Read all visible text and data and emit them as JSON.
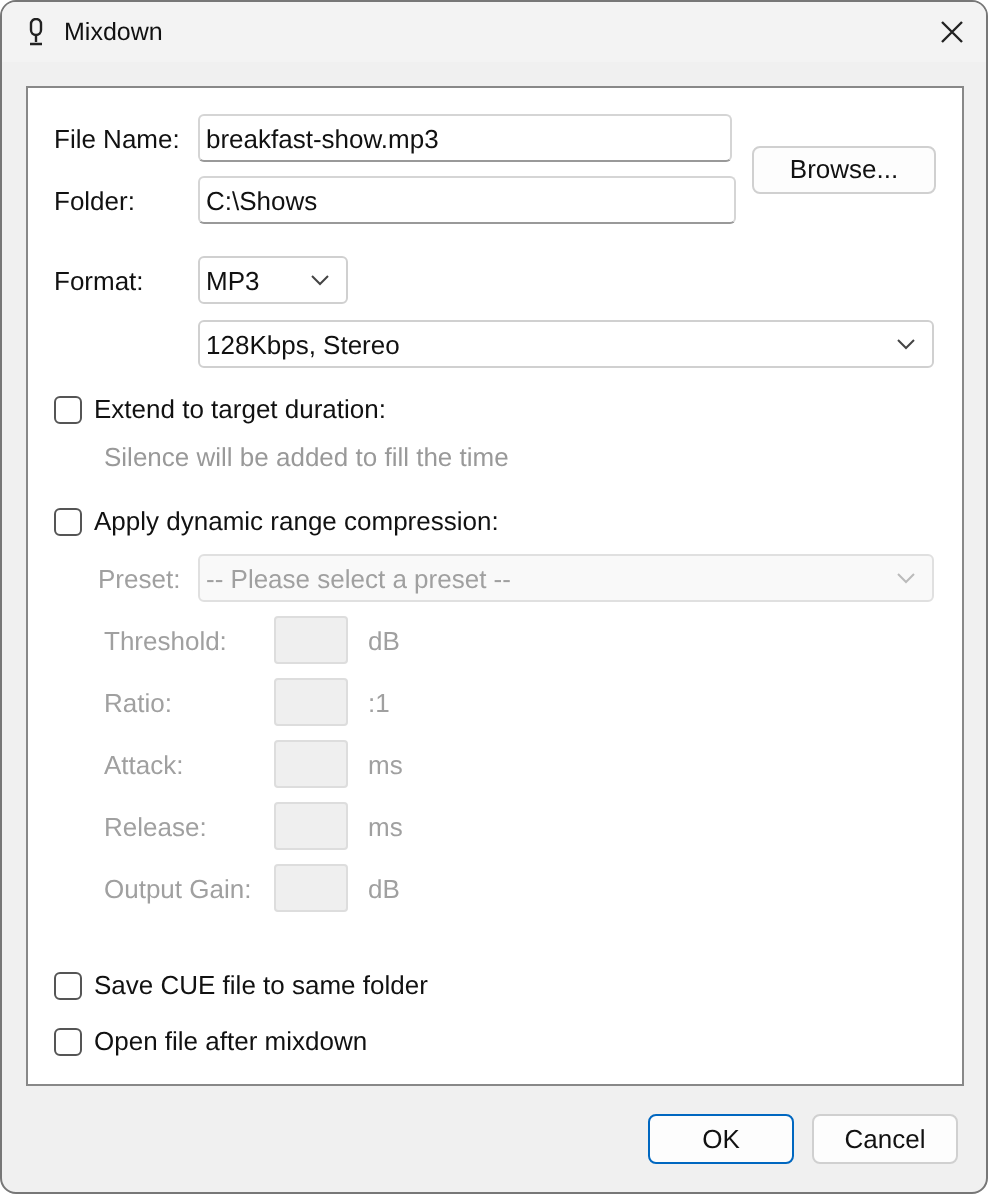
{
  "window": {
    "title": "Mixdown"
  },
  "file_name": {
    "label": "File Name:",
    "value": "breakfast-show.mp3"
  },
  "folder": {
    "label": "Folder:",
    "value": "C:\\Shows"
  },
  "browse_button": "Browse...",
  "format": {
    "label": "Format:",
    "value": "MP3",
    "quality": "128Kbps, Stereo"
  },
  "extend": {
    "label": "Extend to target duration:",
    "checked": false,
    "hint": "Silence will be added to fill the time"
  },
  "compression": {
    "label": "Apply dynamic range compression:",
    "checked": false,
    "disabled": true,
    "preset": {
      "label": "Preset:",
      "placeholder": "-- Please select a preset --"
    },
    "params": [
      {
        "label": "Threshold:",
        "unit": "dB"
      },
      {
        "label": "Ratio:",
        "unit": ":1"
      },
      {
        "label": "Attack:",
        "unit": "ms"
      },
      {
        "label": "Release:",
        "unit": "ms"
      },
      {
        "label": "Output Gain:",
        "unit": "dB"
      }
    ]
  },
  "options": [
    {
      "label": "Save CUE file to same folder",
      "checked": false
    },
    {
      "label": "Open file after mixdown",
      "checked": false
    }
  ],
  "buttons": [
    {
      "label": "OK",
      "default": true
    },
    {
      "label": "Cancel",
      "default": false
    }
  ]
}
